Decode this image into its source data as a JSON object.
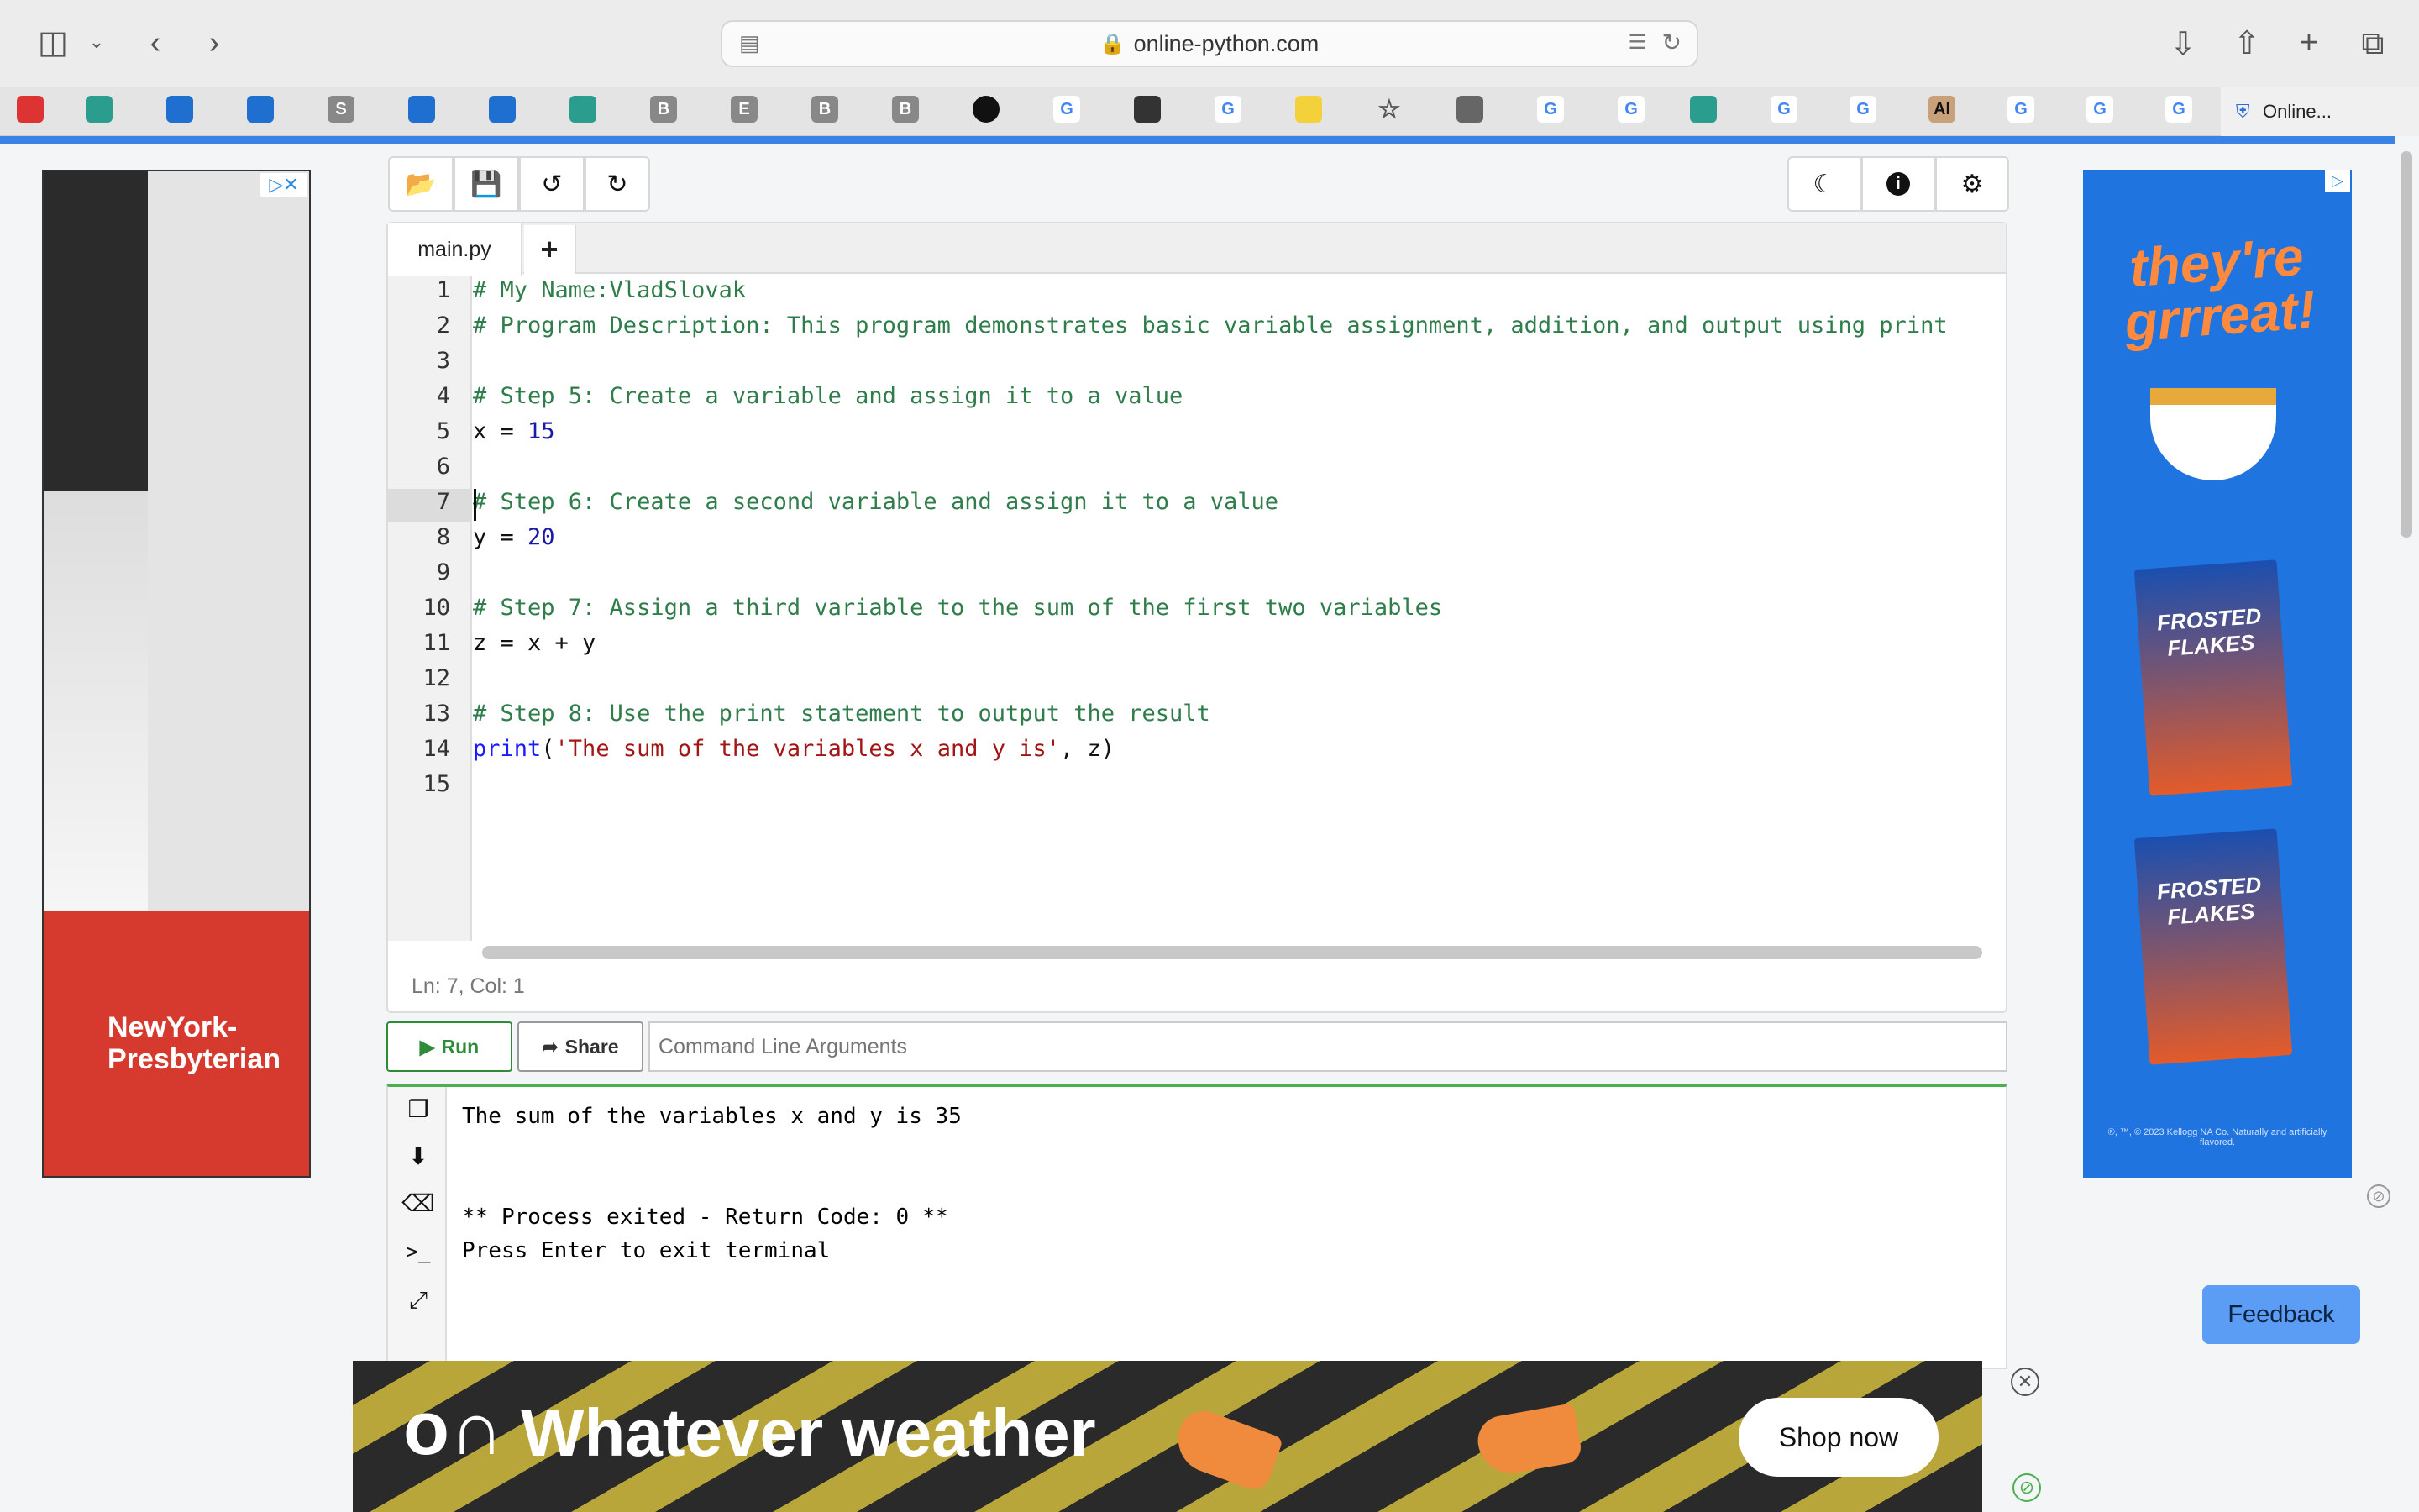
{
  "browser": {
    "url": "online-python.com",
    "last_tab_label": "Online...",
    "bookmark_letters": [
      "S",
      "B",
      "E",
      "B",
      "B",
      "G",
      "G",
      "G",
      "G",
      "G",
      "G",
      "G",
      "G",
      "G",
      "AI"
    ]
  },
  "toolbar": {
    "open_icon": "folder-open-icon",
    "save_icon": "save-icon",
    "undo_icon": "undo-icon",
    "redo_icon": "redo-icon",
    "dark_icon": "moon-icon",
    "info_icon": "info-icon",
    "settings_icon": "gears-icon"
  },
  "editor": {
    "tab_name": "main.py",
    "add_tab": "+",
    "lines": [
      "# My Name:VladSlovak",
      "# Program Description: This program demonstrates basic variable assignment, addition, and output using print",
      "",
      "# Step 5: Create a variable and assign it to a value",
      "x = 15",
      "",
      "# Step 6: Create a second variable and assign it to a value",
      "y = 20",
      "",
      "# Step 7: Assign a third variable to the sum of the first two variables",
      "z = x + y",
      "",
      "# Step 8: Use the print statement to output the result",
      "print('The sum of the variables x and y is', z)",
      ""
    ],
    "line_numbers": [
      "1",
      "2",
      "3",
      "4",
      "5",
      "6",
      "7",
      "8",
      "9",
      "10",
      "11",
      "12",
      "13",
      "14",
      "15"
    ],
    "cursor_status": "Ln: 7,  Col: 1"
  },
  "actions": {
    "run_label": "Run",
    "share_label": "Share",
    "args_placeholder": "Command Line Arguments"
  },
  "terminal": {
    "output": [
      "The sum of the variables x and y is 35",
      "",
      "",
      "** Process exited - Return Code: 0 **",
      "Press Enter to exit terminal"
    ]
  },
  "ads": {
    "left_brand_line1": "NewYork-",
    "left_brand_line2": "Presbyterian",
    "right_slogan_line1": "they're",
    "right_slogan_line2": "grrreat!",
    "right_box1": "FROSTED FLAKES",
    "right_box2": "FROSTED FLAKES",
    "right_fine": "®, ™, © 2023 Kellogg NA Co. Naturally and artificially flavored.",
    "bottom_headline": "Whatever weather",
    "bottom_cta": "Shop now"
  },
  "feedback_label": "Feedback",
  "colors": {
    "accent_run": "#2e8b3a",
    "comment": "#2f7d4a",
    "number": "#1a1aa6",
    "keyword": "#1a1aff",
    "string": "#a31515"
  }
}
